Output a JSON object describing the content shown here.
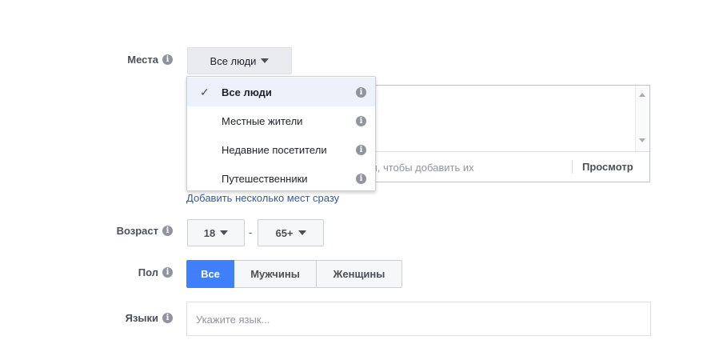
{
  "places": {
    "label": "Места",
    "selected": "Все люди",
    "options": [
      {
        "label": "Все люди",
        "checked": true
      },
      {
        "label": "Местные жители",
        "checked": false
      },
      {
        "label": "Недавние посетители",
        "checked": false
      },
      {
        "label": "Путешественники",
        "checked": false
      }
    ],
    "input_placeholder_visible": "чки, чтобы добавить их",
    "preview_label": "Просмотр",
    "bulk_link": "Добавить несколько мест сразу"
  },
  "age": {
    "label": "Возраст",
    "min": "18",
    "separator": "-",
    "max": "65+"
  },
  "gender": {
    "label": "Пол",
    "options": [
      "Все",
      "Мужчины",
      "Женщины"
    ],
    "selected_index": 0
  },
  "languages": {
    "label": "Языки",
    "placeholder": "Укажите язык..."
  },
  "colors": {
    "accent": "#4080ff",
    "link": "#365899",
    "selected_row": "#edf2fa"
  },
  "icons": {
    "info": "info-icon",
    "check": "check-icon",
    "caret": "caret-down-icon"
  }
}
